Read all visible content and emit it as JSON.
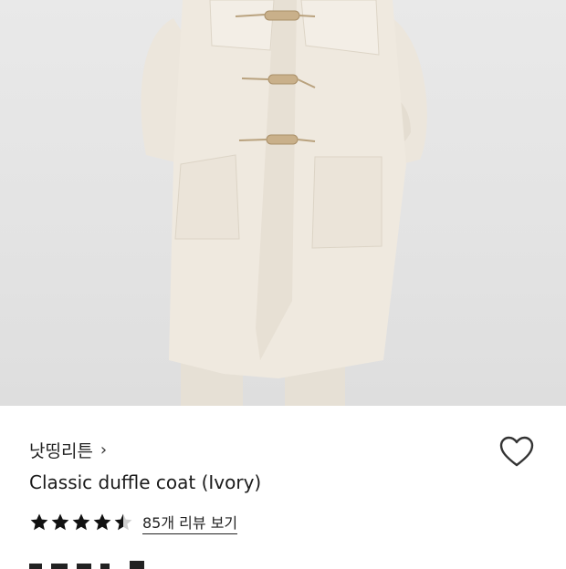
{
  "product": {
    "image_alt": "Ivory duffle coat with wooden toggles",
    "brand": "낫띵리튼",
    "brand_chevron": "›",
    "name": "Classic duffle coat (Ivory)",
    "rating": 4.5,
    "rating_max": 5,
    "review_link": "85개 리뷰 보기"
  },
  "icons": {
    "brand_arrow": "chevron-right-icon",
    "wishlist": "heart-outline-icon",
    "star": "star-icon"
  },
  "colors": {
    "star_fill": "#111111",
    "star_empty": "#cfcfcf",
    "coat": "#efe9df",
    "toggle": "#c9b08a"
  }
}
